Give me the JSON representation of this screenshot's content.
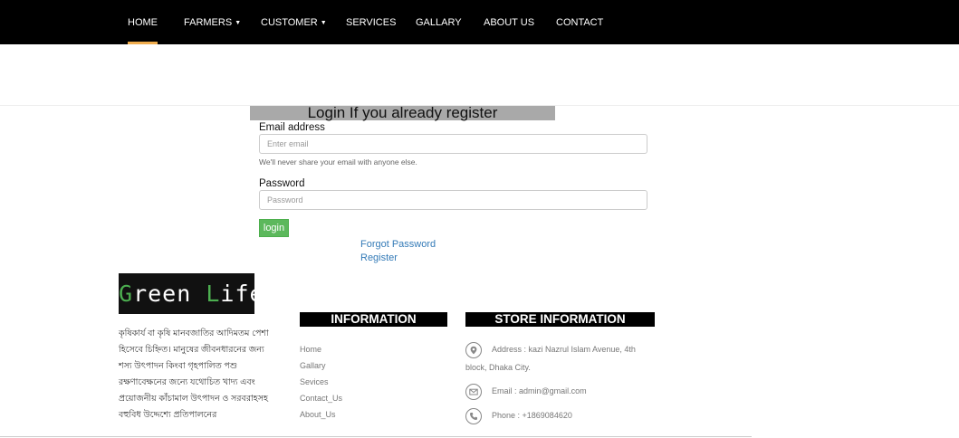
{
  "nav": {
    "items": [
      {
        "label": "HOME",
        "active": true,
        "dropdown": false
      },
      {
        "label": "FARMERS",
        "active": false,
        "dropdown": true
      },
      {
        "label": "CUSTOMER",
        "active": false,
        "dropdown": true
      },
      {
        "label": "SERVICES",
        "active": false,
        "dropdown": false
      },
      {
        "label": "GALLARY",
        "active": false,
        "dropdown": false
      },
      {
        "label": "ABOUT US",
        "active": false,
        "dropdown": false
      },
      {
        "label": "CONTACT",
        "active": false,
        "dropdown": false
      }
    ],
    "active_color": "#f0ad4e"
  },
  "login": {
    "heading": "Login If you already register",
    "email_label": "Email address",
    "email_placeholder": "Enter email",
    "email_value": "",
    "email_help": "We'll never share your email with anyone else.",
    "password_label": "Password",
    "password_placeholder": "Password",
    "password_value": "",
    "submit_label": "login",
    "forgot_link": "Forgot Password",
    "register_link": "Register"
  },
  "footer": {
    "brand": {
      "part1": "G",
      "part2": "reen ",
      "part3": "L",
      "part4": "ife"
    },
    "about_text": "কৃষিকার্য বা কৃষি মানবজাতির আদিমতম পেশা হিসেবে চিহ্নিত। মানুষের জীবনধারনের জন্য শস্য উৎপাদন কিংবা গৃহপালিত পশু রক্ষণাবেক্ষনের জন্যে যথোচিত খাদ্য এবং প্রয়োজনীয় কাঁচামাল উৎপাদন ও সরবরাহসহ বহুবিধ উদ্দেশ্যে প্রতিপালনের",
    "information": {
      "heading": "INFORMATION",
      "links": [
        "Home",
        "Gallary",
        "Sevices",
        "Contact_Us",
        "About_Us"
      ]
    },
    "store": {
      "heading": "STORE INFORMATION",
      "address_line1": "Address : kazi Nazrul Islam Avenue, 4th",
      "address_line2": "block, Dhaka City.",
      "email": "Email : admin@gmail.com",
      "phone": "Phone : +1869084620",
      "icons": [
        "map-pin-icon",
        "envelope-icon",
        "phone-icon"
      ]
    }
  },
  "colors": {
    "navbar_bg": "#000000",
    "login_button": "#5cb85c",
    "link": "#337ab7",
    "brand_accent": "#4caf50"
  }
}
